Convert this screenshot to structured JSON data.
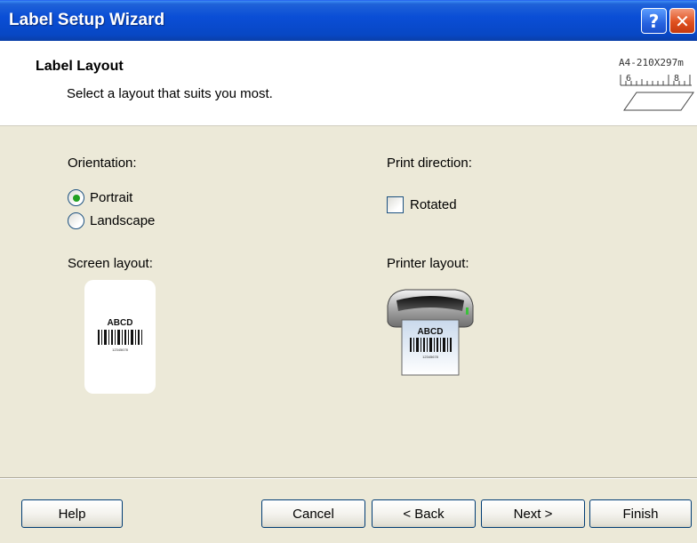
{
  "window": {
    "title": "Label Setup Wizard",
    "help_glyph": "?",
    "close_glyph": "✕"
  },
  "header": {
    "title": "Label Layout",
    "subtitle": "Select a layout that suits you most.",
    "paper_size": "A4-210X297m",
    "ruler_marks": [
      "6",
      "8"
    ]
  },
  "orientation": {
    "label": "Orientation:",
    "options": [
      {
        "label": "Portrait",
        "selected": true
      },
      {
        "label": "Landscape",
        "selected": false
      }
    ]
  },
  "print_direction": {
    "label": "Print direction:",
    "rotated_label": "Rotated",
    "rotated_checked": false
  },
  "screen_layout": {
    "label": "Screen layout:",
    "sample_text": "ABCD",
    "sample_number": "12345678"
  },
  "printer_layout": {
    "label": "Printer layout:",
    "sample_text": "ABCD",
    "sample_number": "12345678"
  },
  "buttons": {
    "help": "Help",
    "cancel": "Cancel",
    "back": "< Back",
    "next": "Next >",
    "finish": "Finish"
  },
  "colors": {
    "titlebar": "#0a4ed6",
    "dialog_bg": "#ece9d8",
    "radio_selected": "#21a121"
  }
}
